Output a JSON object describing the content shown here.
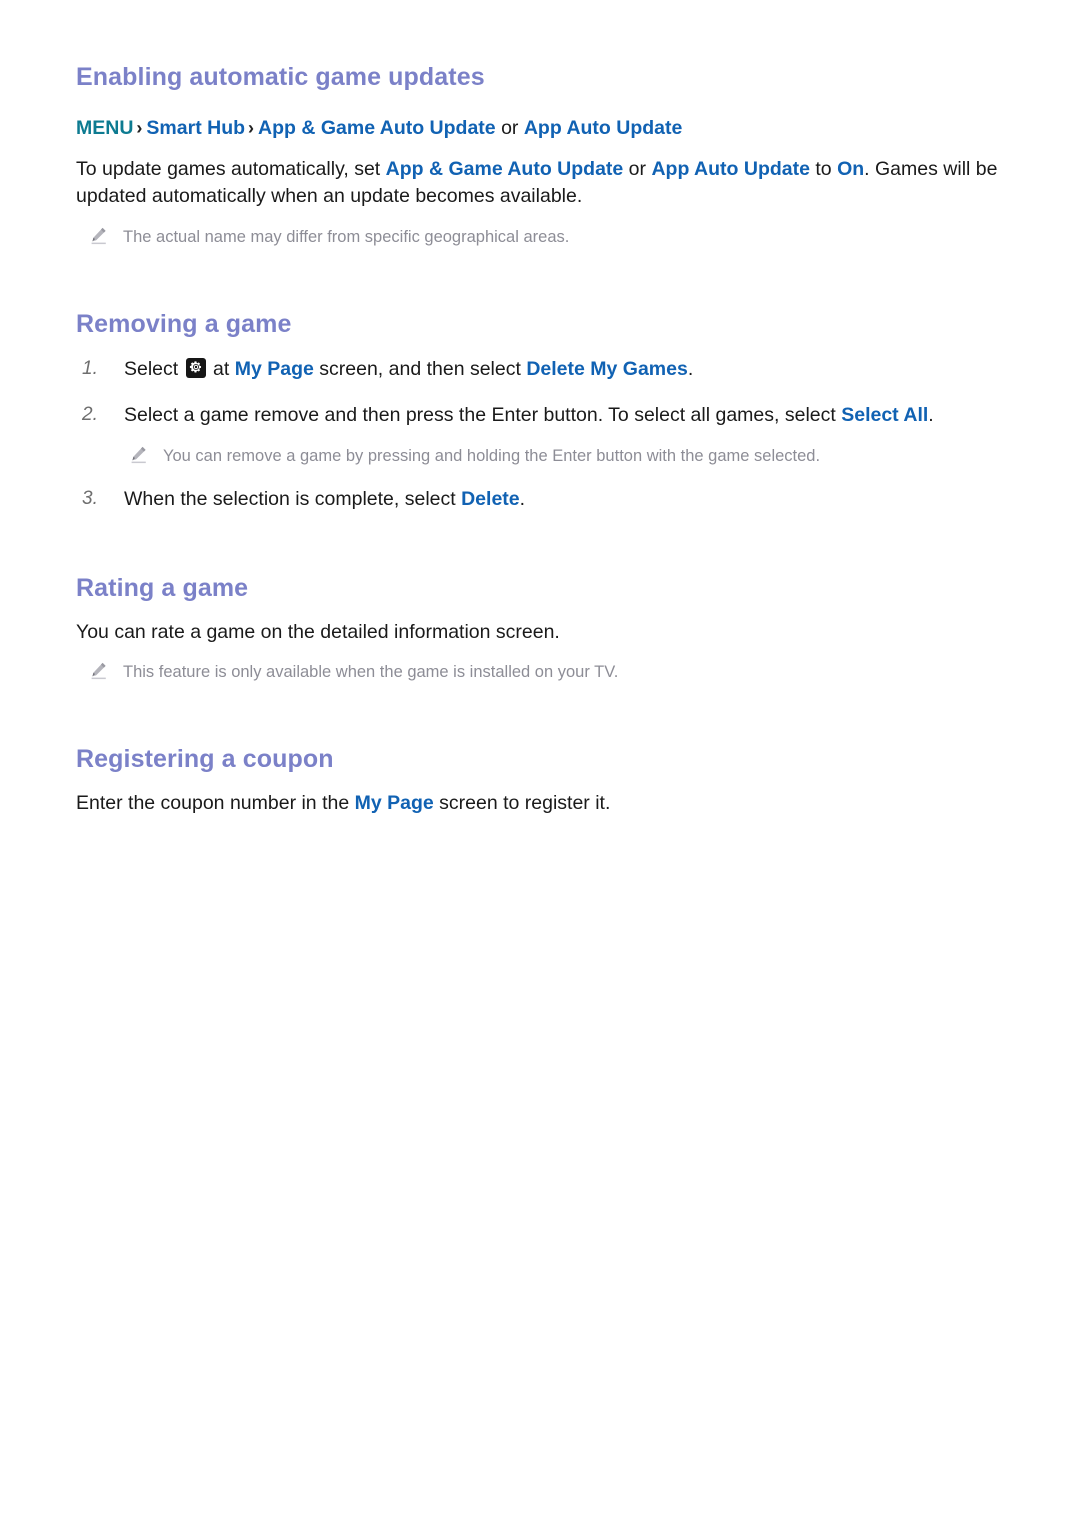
{
  "document": {
    "background_color": "#ffffff",
    "heading_color": "#7b81c8",
    "link_color": "#1162b3",
    "menu_color": "#0d7b91",
    "note_color": "#8d8d96",
    "body_color": "#1a1a1a"
  },
  "sections": [
    {
      "heading": "Enabling automatic game updates",
      "menu_path": {
        "menu_label": "MENU",
        "chevron": "›",
        "item1": "Smart Hub",
        "item2": "App & Game Auto Update",
        "conjunction": "or",
        "item3": "App Auto Update"
      },
      "paragraph": {
        "part1": "To update games automatically, set ",
        "link1": "App & Game Auto Update",
        "part2": " or ",
        "link2": "App Auto Update",
        "part3": " to ",
        "link3": "On",
        "part4": ". Games will be updated automatically when an update becomes available."
      },
      "note": "The actual name may differ from specific geographical areas."
    },
    {
      "heading": "Removing a game",
      "steps": [
        {
          "number": "1.",
          "icon": "gear-icon",
          "text_before_icon": "Select ",
          "text_after_icon": " at ",
          "link1": "My Page",
          "text_mid": " screen, and then select ",
          "link2": "Delete My Games",
          "text_end": "."
        },
        {
          "number": "2.",
          "text_start": "Select a game remove and then press the Enter button. To select all games, select ",
          "link1": "Select All",
          "text_end": "."
        },
        {
          "number": "3.",
          "text_start": "When the selection is complete, select ",
          "link1": "Delete",
          "text_end": "."
        }
      ],
      "note_after_step2": "You can remove a game by pressing and holding the Enter button with the game selected."
    },
    {
      "heading": "Rating a game",
      "paragraph": "You can rate a game on the detailed information screen.",
      "note": "This feature is only available when the game is installed on your TV."
    },
    {
      "heading": "Registering a coupon",
      "paragraph": {
        "part1": "Enter the coupon number in the ",
        "link1": "My Page",
        "part2": " screen to register it."
      }
    }
  ]
}
